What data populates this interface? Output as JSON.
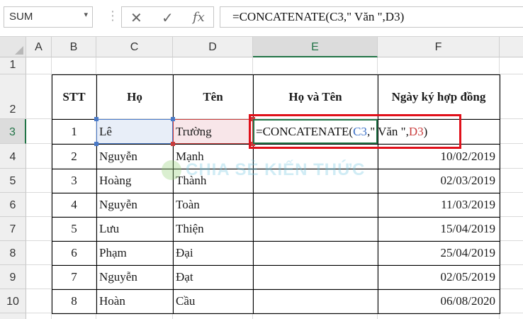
{
  "name_box": {
    "value": "SUM"
  },
  "formula_bar": {
    "formula": "=CONCATENATE(C3,\" Văn \",D3)",
    "cancel_symbol": "✕",
    "enter_symbol": "✓",
    "fx_symbol": "fx"
  },
  "columns": [
    "A",
    "B",
    "C",
    "D",
    "E",
    "F"
  ],
  "rows": [
    "1",
    "2",
    "3",
    "4",
    "5",
    "6",
    "7",
    "8",
    "9",
    "10"
  ],
  "active_cell": "E3",
  "table": {
    "headers": [
      "STT",
      "Họ",
      "Tên",
      "Họ và Tên",
      "Ngày ký hợp đồng"
    ],
    "rows": [
      {
        "stt": "1",
        "ho": "Lê",
        "ten": "Trường",
        "ngay": ""
      },
      {
        "stt": "2",
        "ho": "Nguyễn",
        "ten": "Mạnh",
        "ngay": "10/02/2019"
      },
      {
        "stt": "3",
        "ho": "Hoàng",
        "ten": "Thành",
        "ngay": "02/03/2019"
      },
      {
        "stt": "4",
        "ho": "Nguyễn",
        "ten": "Toàn",
        "ngay": "11/03/2019"
      },
      {
        "stt": "5",
        "ho": "Lưu",
        "ten": "Thiện",
        "ngay": "15/04/2019"
      },
      {
        "stt": "6",
        "ho": "Phạm",
        "ten": "Đại",
        "ngay": "25/04/2019"
      },
      {
        "stt": "7",
        "ho": "Nguyễn",
        "ten": "Đạt",
        "ngay": "02/05/2019"
      },
      {
        "stt": "8",
        "ho": "Hoàn",
        "ten": "Cầu",
        "ngay": "06/08/2020"
      }
    ]
  },
  "in_cell_edit": {
    "prefix": "=CONCATENATE(",
    "ref1": "C3",
    "middle": ",\" Văn \",",
    "ref2": "D3",
    "suffix": ")"
  },
  "watermark": {
    "text": "CHIA SẺ KIẾN THỨC"
  },
  "colors": {
    "excel_green": "#217346",
    "ref_blue": "#3a6fc6",
    "ref_red": "#c93c3c",
    "highlight_box": "#e0101a"
  }
}
